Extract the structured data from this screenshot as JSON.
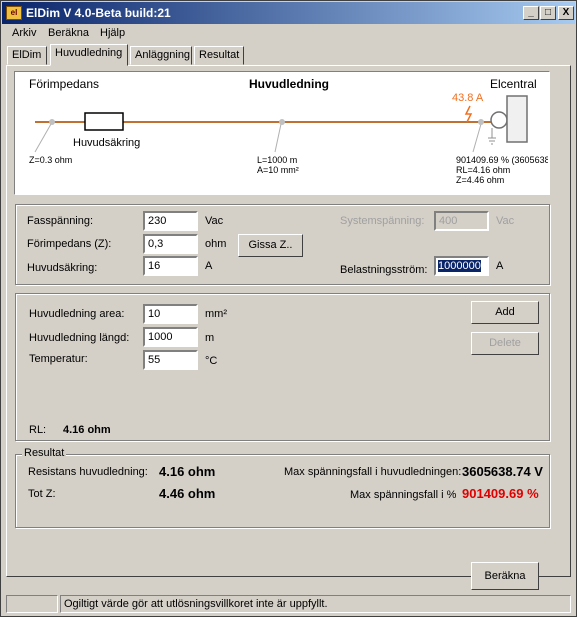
{
  "window": {
    "title": "ElDim V 4.0-Beta build:21",
    "icon_text": "el"
  },
  "titlebar_buttons": {
    "minimize": "_",
    "maximize": "□",
    "close": "X"
  },
  "menu": [
    "Arkiv",
    "Beräkna",
    "Hjälp"
  ],
  "tabs": [
    "ElDim",
    "Huvudledning",
    "Anläggning",
    "Resultat"
  ],
  "active_tab": "Huvudledning",
  "diagram": {
    "left_title": "Förimpedans",
    "center_title": "Huvudledning",
    "right_title": "Elcentral",
    "fuse_label": "Huvudsäkring",
    "current": "43.8 A",
    "left_value": "Z=0.3 ohm",
    "line_length": "L=1000 m",
    "line_area": "A=10 mm²",
    "right_values": [
      "901409.69 % (3605638",
      "RL=4.16 ohm",
      "Z=4.46 ohm"
    ],
    "colors": {
      "line": "#c07030",
      "current": "#f07020"
    }
  },
  "form1": {
    "fasspanning_label": "Fasspänning:",
    "fasspanning_value": "230",
    "fasspanning_unit": "Vac",
    "forimpedans_label": "Förimpedans (Z):",
    "forimpedans_value": "0,3",
    "forimpedans_unit": "ohm",
    "gissa_button": "Gissa Z..",
    "huvudsakring_label": "Huvudsäkring:",
    "huvudsakring_value": "16",
    "huvudsakring_unit": "A",
    "systemspanning_label": "Systemspänning:",
    "systemspanning_value": "400",
    "systemspanning_unit": "Vac",
    "belastning_label": "Belastningsström:",
    "belastning_value": "1000000",
    "belastning_unit": "A"
  },
  "form2": {
    "area_label": "Huvudledning area:",
    "area_value": "10",
    "area_unit": "mm²",
    "langd_label": "Huvudledning längd:",
    "langd_value": "1000",
    "langd_unit": "m",
    "temp_label": "Temperatur:",
    "temp_value": "55",
    "temp_unit": "°C",
    "add_button": "Add",
    "delete_button": "Delete",
    "rl_label": "RL:",
    "rl_value": "4.16 ohm"
  },
  "result": {
    "legend": "Resultat",
    "resistans_label": "Resistans huvudledning:",
    "resistans_value": "4.16 ohm",
    "totz_label": "Tot Z:",
    "totz_value": "4.46 ohm",
    "max_v_label": "Max spänningsfall i huvudledningen:",
    "max_v_value": "3605638.74 V",
    "max_pct_label": "Max spänningsfall i %",
    "max_pct_value": "901409.69 %"
  },
  "berakna_button": "Beräkna",
  "status": {
    "left": "",
    "message": "Ogiltigt värde gör att utlösningsvillkoret inte är uppfyllt."
  }
}
